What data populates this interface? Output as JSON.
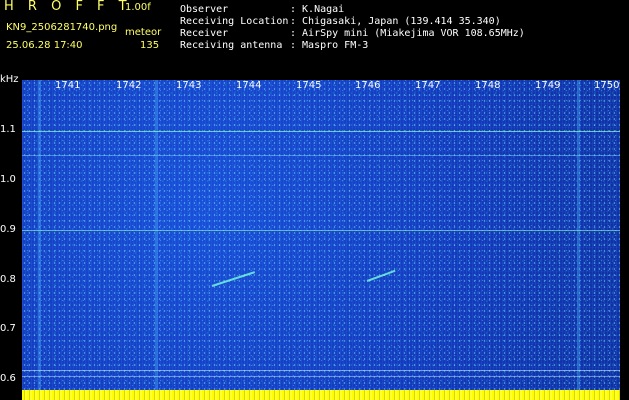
{
  "header": {
    "app_title": "H R O F F T",
    "version": "1.00f",
    "file_name": "KN9_2506281740.png",
    "mode": "meteor",
    "date_time": "25.06.28 17:40",
    "frame_count": "135"
  },
  "info": {
    "observer_label": "Observer",
    "observer_value": ": K.Nagai",
    "location_label": "Receiving Location",
    "location_value": ": Chigasaki, Japan (139.414 35.340)",
    "receiver_label": "Receiver",
    "receiver_value": ": AirSpy mini (Miakejima VOR 108.65MHz)",
    "antenna_label": "Receiving antenna",
    "antenna_value": ": Maspro FM-3"
  },
  "axis": {
    "unit": "kHz",
    "y_ticks": [
      "1.1",
      "1.0",
      "0.9",
      "0.8",
      "0.7",
      "0.6"
    ],
    "minutes": [
      "1741",
      "1742",
      "1743",
      "1744",
      "1745",
      "1746",
      "1747",
      "1748",
      "1749",
      "1750"
    ]
  },
  "colors": {
    "background": "#000000",
    "header_text": "#ffff66",
    "info_text": "#ffffff",
    "spectrum_base": "#1438b8",
    "baseline": "#ffff00"
  }
}
